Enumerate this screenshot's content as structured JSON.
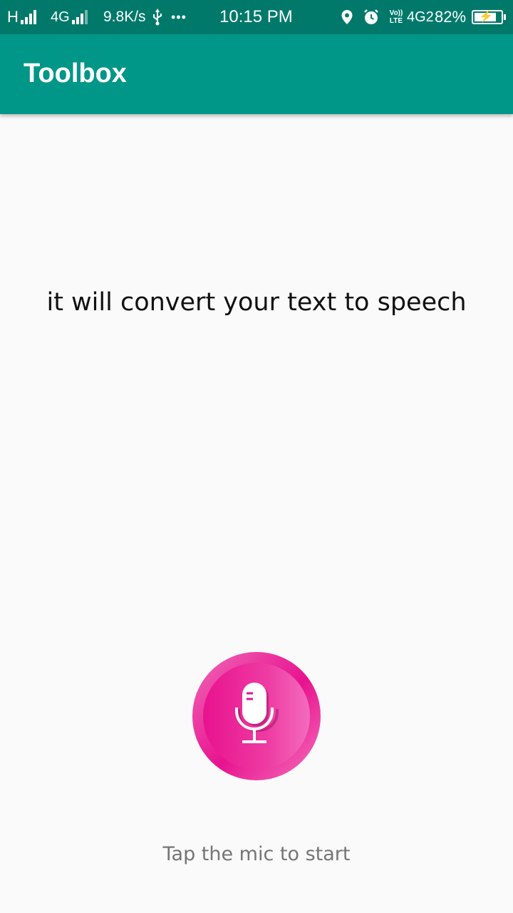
{
  "status_bar": {
    "network_h": "H",
    "network_4g": "4G",
    "speed": "9.8K/s",
    "usb_icon": "usb-icon",
    "more_dots": "•••",
    "time": "10:15 PM",
    "volte": "Vo)) LTE",
    "network_4g2": "4G2",
    "battery_percent": "82%",
    "battery_level": 0.82
  },
  "app_bar": {
    "title": "Toolbox",
    "color": "#009688"
  },
  "main": {
    "description": "it will convert your text to speech",
    "mic_icon": "microphone-icon",
    "mic_color": "#e8128e",
    "hint": "Tap the mic to start"
  }
}
